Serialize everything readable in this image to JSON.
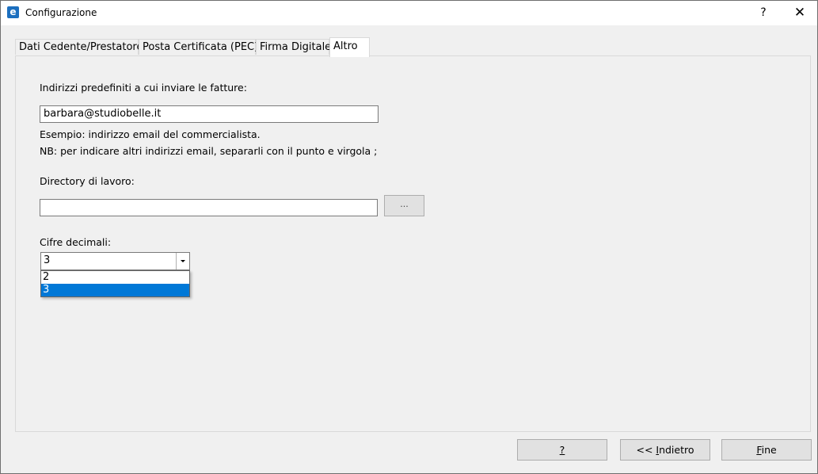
{
  "window": {
    "title": "Configurazione",
    "help": "?",
    "close": "✕"
  },
  "tabs": [
    {
      "label": "Dati Cedente/Prestatore",
      "active": false
    },
    {
      "label": "Posta Certificata (PEC)",
      "active": false
    },
    {
      "label": "Firma Digitale",
      "active": false
    },
    {
      "label": "Altro",
      "active": true
    }
  ],
  "form": {
    "emails_label": "Indirizzi predefiniti a cui inviare le fatture:",
    "emails_value": "barbara@studiobelle.it",
    "example_text": "Esempio: indirizzo email del commercialista.",
    "nb_text": "NB: per indicare altri indirizzi email, separarli con il punto e virgola ;",
    "workdir_label": "Directory di lavoro:",
    "workdir_value": "",
    "browse_label": "...",
    "decimals_label": "Cifre decimali:",
    "decimals_value": "3",
    "decimals_options": [
      "2",
      "3"
    ]
  },
  "buttons": {
    "help_label": "?",
    "back_prefix": "<< ",
    "back_accel": "I",
    "back_rest": "ndietro",
    "finish_accel": "F",
    "finish_rest": "ine"
  }
}
